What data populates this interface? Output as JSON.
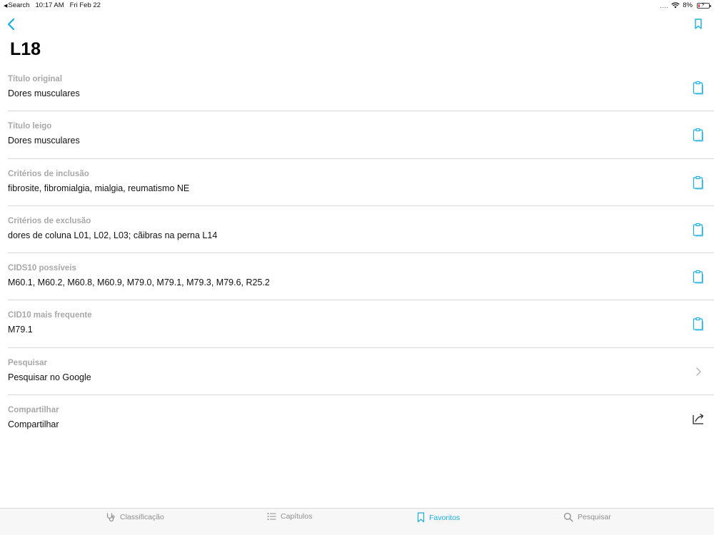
{
  "status_bar": {
    "back_app": "Search",
    "time": "10:17 AM",
    "date": "Fri Feb 22",
    "signal": "....",
    "battery": "8%"
  },
  "header": {
    "title": "L18"
  },
  "rows": [
    {
      "label": "Título original",
      "value": "Dores musculares",
      "action": "clipboard-icon"
    },
    {
      "label": "Título leigo",
      "value": "Dores musculares",
      "action": "clipboard-icon"
    },
    {
      "label": "Critérios de inclusão",
      "value": "fibrosite, fibromialgia, mialgia, reumatismo NE",
      "action": "clipboard-icon"
    },
    {
      "label": "Critérios de exclusão",
      "value": "dores de coluna L01, L02, L03; cãibras na perna L14",
      "action": "clipboard-icon"
    },
    {
      "label": "CIDS10 possíveis",
      "value": "M60.1, M60.2, M60.8, M60.9, M79.0, M79.1, M79.3, M79.6, R25.2",
      "action": "clipboard-icon"
    },
    {
      "label": "CID10 mais frequente",
      "value": "M79.1",
      "action": "clipboard-icon"
    },
    {
      "label": "Pesquisar",
      "value": "Pesquisar no Google",
      "action": "chevron-right-icon"
    },
    {
      "label": "Compartilhar",
      "value": "Compartilhar",
      "action": "share-icon"
    }
  ],
  "tabs": [
    {
      "label": "Classificação",
      "icon": "stethoscope-icon",
      "active": false
    },
    {
      "label": "Capítulos",
      "icon": "list-icon",
      "active": false
    },
    {
      "label": "Favoritos",
      "icon": "bookmark-icon",
      "active": true
    },
    {
      "label": "Pesquisar",
      "icon": "search-icon",
      "active": false
    }
  ],
  "colors": {
    "accent": "#19AEE0",
    "label_gray": "#A8A8A8",
    "divider": "#D7D7D7",
    "tab_inactive": "#8E8E8E"
  }
}
